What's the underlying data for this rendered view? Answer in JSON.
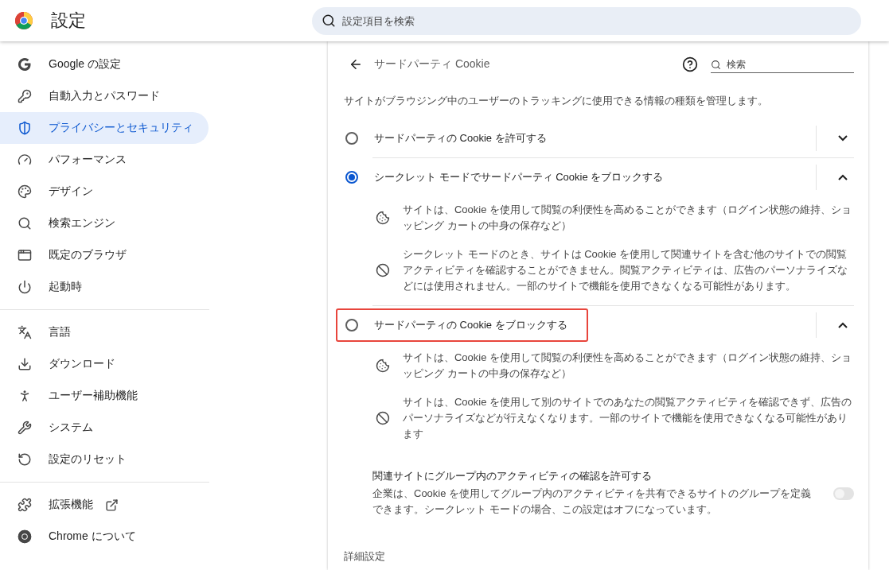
{
  "header": {
    "title": "設定",
    "search": {
      "placeholder": "設定項目を検索"
    }
  },
  "sidebar": {
    "groups": [
      {
        "items": [
          {
            "label": "Google の設定",
            "selected": false
          },
          {
            "label": "自動入力とパスワード",
            "selected": false
          },
          {
            "label": "プライバシーとセキュリティ",
            "selected": true
          },
          {
            "label": "パフォーマンス",
            "selected": false
          },
          {
            "label": "デザイン",
            "selected": false
          },
          {
            "label": "検索エンジン",
            "selected": false
          },
          {
            "label": "既定のブラウザ",
            "selected": false
          },
          {
            "label": "起動時",
            "selected": false
          }
        ]
      },
      {
        "items": [
          {
            "label": "言語",
            "selected": false
          },
          {
            "label": "ダウンロード",
            "selected": false
          },
          {
            "label": "ユーザー補助機能",
            "selected": false
          },
          {
            "label": "システム",
            "selected": false
          },
          {
            "label": "設定のリセット",
            "selected": false
          }
        ]
      },
      {
        "items": [
          {
            "label": "拡張機能",
            "selected": false,
            "external": true
          },
          {
            "label": "Chrome について",
            "selected": false
          }
        ]
      }
    ]
  },
  "page": {
    "title": "サードパーティ Cookie",
    "search": {
      "placeholder": "検索"
    },
    "description": "サイトがブラウジング中のユーザーのトラッキングに使用できる情報の種類を管理します。",
    "options": [
      {
        "label": "サードパーティの Cookie を許可する",
        "selected": false,
        "expanded": false,
        "highlighted": false
      },
      {
        "label": "シークレット モードでサードパーティ Cookie をブロックする",
        "selected": true,
        "expanded": true,
        "highlighted": false,
        "details": [
          {
            "kind": "cookie",
            "text": "サイトは、Cookie を使用して閲覧の利便性を高めることができます（ログイン状態の維持、ショッピング カートの中身の保存など）"
          },
          {
            "kind": "block",
            "text": "シークレット モードのとき、サイトは Cookie を使用して関連サイトを含む他のサイトでの閲覧アクティビティを確認することができません。閲覧アクティビティは、広告のパーソナライズなどには使用されません。一部のサイトで機能を使用できなくなる可能性があります。"
          }
        ]
      },
      {
        "label": "サードパーティの Cookie をブロックする",
        "selected": false,
        "expanded": true,
        "highlighted": true,
        "details": [
          {
            "kind": "cookie",
            "text": "サイトは、Cookie を使用して閲覧の利便性を高めることができます（ログイン状態の維持、ショッピング カートの中身の保存など）"
          },
          {
            "kind": "block",
            "text": "サイトは、Cookie を使用して別のサイトでのあなたの閲覧アクティビティを確認できず、広告のパーソナライズなどが行えなくなります。一部のサイトで機能を使用できなくなる可能性があります"
          }
        ],
        "toggle": {
          "title": "関連サイトにグループ内のアクティビティの確認を許可する",
          "description": "企業は、Cookie を使用してグループ内のアクティビティを共有できるサイトのグループを定義できます。シークレット モードの場合、この設定はオフになっています。",
          "on": false,
          "disabled": true
        }
      }
    ],
    "advanced": "詳細設定"
  }
}
